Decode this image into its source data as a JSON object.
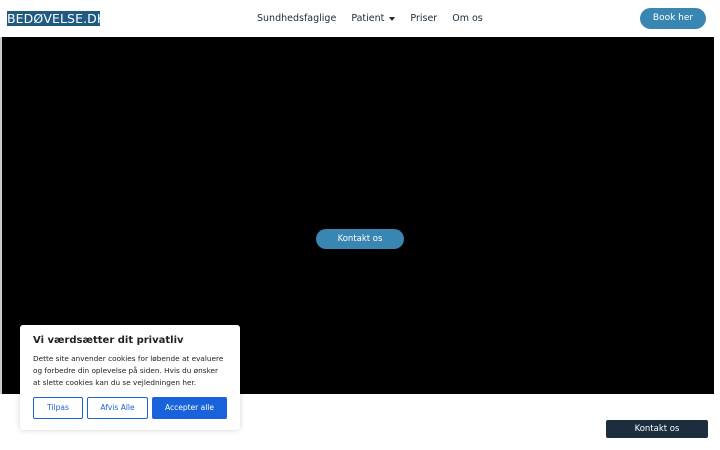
{
  "header": {
    "logo_text": "BEDØVELSE.DK",
    "nav": [
      {
        "label": "Sundhedsfaglige"
      },
      {
        "label": "Patient"
      },
      {
        "label": "Priser"
      },
      {
        "label": "Om os"
      }
    ],
    "book_label": "Book her"
  },
  "hero": {
    "contact_label": "Kontakt os"
  },
  "cookie_banner": {
    "title": "Vi værdsætter dit privatliv",
    "text": "Dette site anvender cookies for løbende at evaluere og forbedre din oplevelse på siden. Hvis du ønsker at slette cookies kan du se vejledningen her.",
    "customize_label": "Tilpas",
    "reject_label": "Afvis Alle",
    "accept_label": "Accepter alle"
  },
  "floating_contact_label": "Kontakt os",
  "colors": {
    "brand_blue": "#3a86b3",
    "logo_bg": "#1f5a82",
    "cookie_blue": "#1863dc",
    "dark_button": "#1c2e3d"
  }
}
